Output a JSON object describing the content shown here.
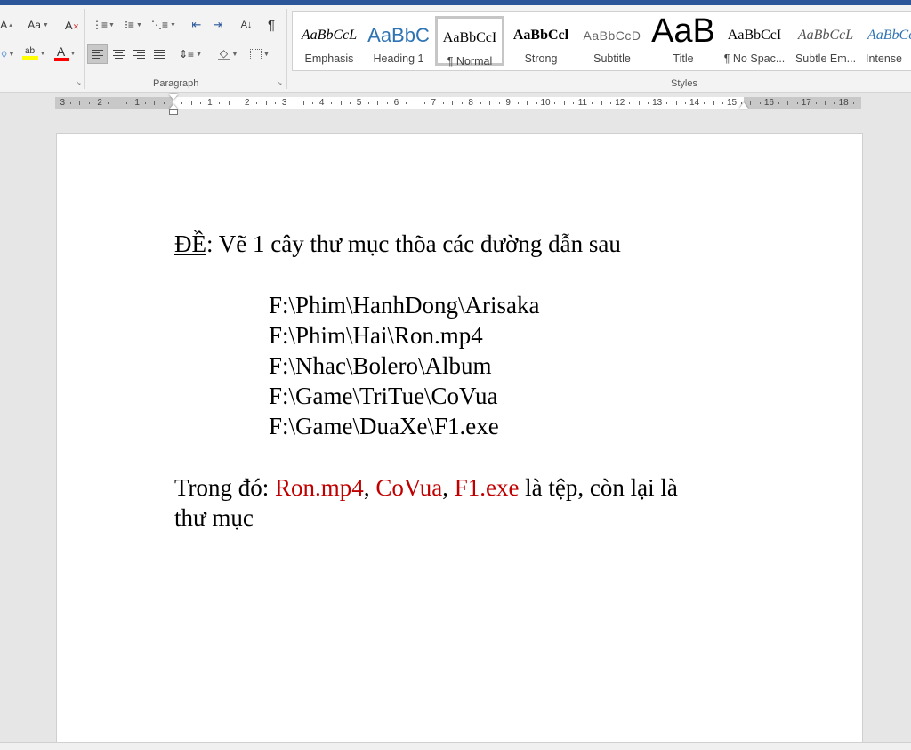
{
  "ribbon": {
    "paragraph_group_label": "Paragraph",
    "styles_group_label": "Styles",
    "font_size_glyph": "A",
    "change_case_label": "Aa",
    "highlight_glyph": "ab",
    "font_color_glyph": "A",
    "sort_glyph": "A↓",
    "pilcrow_glyph": "¶",
    "accent_blue": "#2b579a",
    "highlight_color": "#ffff00",
    "font_color": "#ff0000"
  },
  "styles": [
    {
      "preview": "AaBbCcL",
      "name": "Emphasis"
    },
    {
      "preview": "AaBbC",
      "name": "Heading 1"
    },
    {
      "preview": "AaBbCcI",
      "name": "¶ Normal"
    },
    {
      "preview": "AaBbCcl",
      "name": "Strong"
    },
    {
      "preview": "AaBbCcD",
      "name": "Subtitle"
    },
    {
      "preview": "AaB",
      "name": "Title"
    },
    {
      "preview": "AaBbCcI",
      "name": "¶ No Spac..."
    },
    {
      "preview": "AaBbCcL",
      "name": "Subtle Em..."
    },
    {
      "preview": "AaBbCcL",
      "name": "Intense"
    }
  ],
  "ruler": {
    "left_numbers": [
      "3",
      "2",
      "1"
    ],
    "right_numbers": [
      "1",
      "2",
      "3",
      "4",
      "5",
      "6",
      "7",
      "8",
      "9",
      "10",
      "11",
      "12",
      "13",
      "14",
      "15",
      "16",
      "17",
      "18"
    ]
  },
  "document": {
    "title_label": "ĐỀ",
    "title_text": ": Vẽ 1 cây thư mục thõa các đường dẫn sau",
    "paths": [
      "F:\\Phim\\HanhDong\\Arisaka",
      "F:\\Phim\\Hai\\Ron.mp4",
      "F:\\Nhac\\Bolero\\Album",
      "F:\\Game\\TriTue\\CoVua",
      "F:\\Game\\DuaXe\\F1.exe"
    ],
    "note_prefix": "Trong đó: ",
    "file1": "Ron.mp4",
    "sep1": ", ",
    "file2": "CoVua",
    "sep2": ", ",
    "file3": "F1.exe",
    "note_suffix": " là tệp, còn lại là",
    "note_line2": "thư mục",
    "red_color": "#c00000"
  }
}
